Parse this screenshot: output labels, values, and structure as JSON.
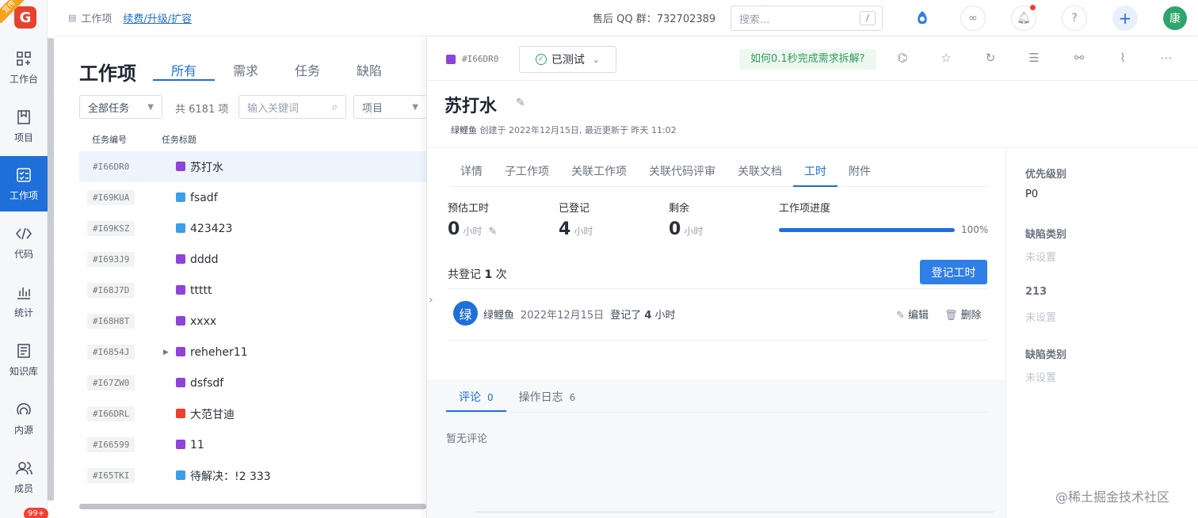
{
  "leftnav": {
    "logo_corner": "宣传",
    "items": [
      {
        "label": "工作台",
        "icon": "dashboard-icon"
      },
      {
        "label": "项目",
        "icon": "project-icon"
      },
      {
        "label": "工作项",
        "icon": "workitem-icon"
      },
      {
        "label": "代码",
        "icon": "code-icon"
      },
      {
        "label": "统计",
        "icon": "chart-icon"
      },
      {
        "label": "知识库",
        "icon": "book-icon"
      },
      {
        "label": "内源",
        "icon": "source-icon"
      },
      {
        "label": "成员",
        "icon": "members-icon"
      }
    ],
    "badge": "99+"
  },
  "topbar": {
    "crumb": "工作项",
    "renew_link": "续费/升级/扩容",
    "qq_label": "售后 QQ 群：732702389",
    "search_placeholder": "搜索...",
    "search_shortcut": "/",
    "avatar": "康"
  },
  "list": {
    "title": "工作项",
    "tabs": [
      "所有",
      "需求",
      "任务",
      "缺陷"
    ],
    "filter_scope": "全部任务",
    "count": "共 6181 项",
    "keyword_placeholder": "输入关键词",
    "project_filter": "项目",
    "col_code": "任务编号",
    "col_title": "任务标题",
    "rows": [
      {
        "code": "#I66DR0",
        "title": "苏打水",
        "color": "#8e44d9"
      },
      {
        "code": "#I69KUA",
        "title": "fsadf",
        "color": "#3d9ee8"
      },
      {
        "code": "#I69KSZ",
        "title": "423423",
        "color": "#3d9ee8"
      },
      {
        "code": "#I693J9",
        "title": "dddd",
        "color": "#8e44d9"
      },
      {
        "code": "#I68J7D",
        "title": "ttttt",
        "color": "#8e44d9"
      },
      {
        "code": "#I68H8T",
        "title": "xxxx",
        "color": "#8e44d9"
      },
      {
        "code": "#I6854J",
        "title": "reheher11",
        "color": "#8e44d9"
      },
      {
        "code": "#I67ZW0",
        "title": "dsfsdf",
        "color": "#8e44d9"
      },
      {
        "code": "#I66DRL",
        "title": "大范甘迪",
        "color": "#e8412c"
      },
      {
        "code": "#I66599",
        "title": "11",
        "color": "#8e44d9"
      },
      {
        "code": "#I65TKI",
        "title": "待解决：!2 333",
        "color": "#3d9ee8"
      }
    ]
  },
  "detail": {
    "code": "#I66DR0",
    "status": "已测试",
    "hint": "如何0.1秒完成需求拆解?",
    "name": "苏打水",
    "author": "绿鲤鱼",
    "meta": "创建于 2022年12月15日, 最近更新于 昨天 11:02",
    "tabs": [
      "详情",
      "子工作项",
      "关联工作项",
      "关联代码评审",
      "关联文档",
      "工时",
      "附件"
    ],
    "estimate_label": "预估工时",
    "estimate_value": "0",
    "registered_label": "已登记",
    "registered_value": "4",
    "remaining_label": "剩余",
    "remaining_value": "0",
    "unit": "小时",
    "progress_label": "工作项进度",
    "progress_value": 1.0,
    "progress_text": "100%",
    "logged_prefix": "共登记",
    "logged_count": "1",
    "logged_suffix": "次",
    "log_button": "登记工时",
    "log_entry": {
      "avatar": "绿",
      "user": "绿鲤鱼",
      "date": "2022年12月15日",
      "text_prefix": "登记了",
      "hours": "4",
      "text_suffix": "小时",
      "edit": "编辑",
      "delete": "删除"
    },
    "comment_tabs": [
      {
        "label": "评论",
        "count": "0"
      },
      {
        "label": "操作日志",
        "count": "6"
      }
    ],
    "no_comment": "暂无评论",
    "side": {
      "priority_label": "优先级别",
      "priority_value": "P0",
      "bug_type_label": "缺陷类别",
      "bug_type_value": "未设置",
      "field_213_label": "213",
      "field_213_value": "未设置",
      "bug_type2_label": "缺陷类别",
      "bug_type2_value": "未设置"
    }
  },
  "watermark": "@稀土掘金技术社区"
}
